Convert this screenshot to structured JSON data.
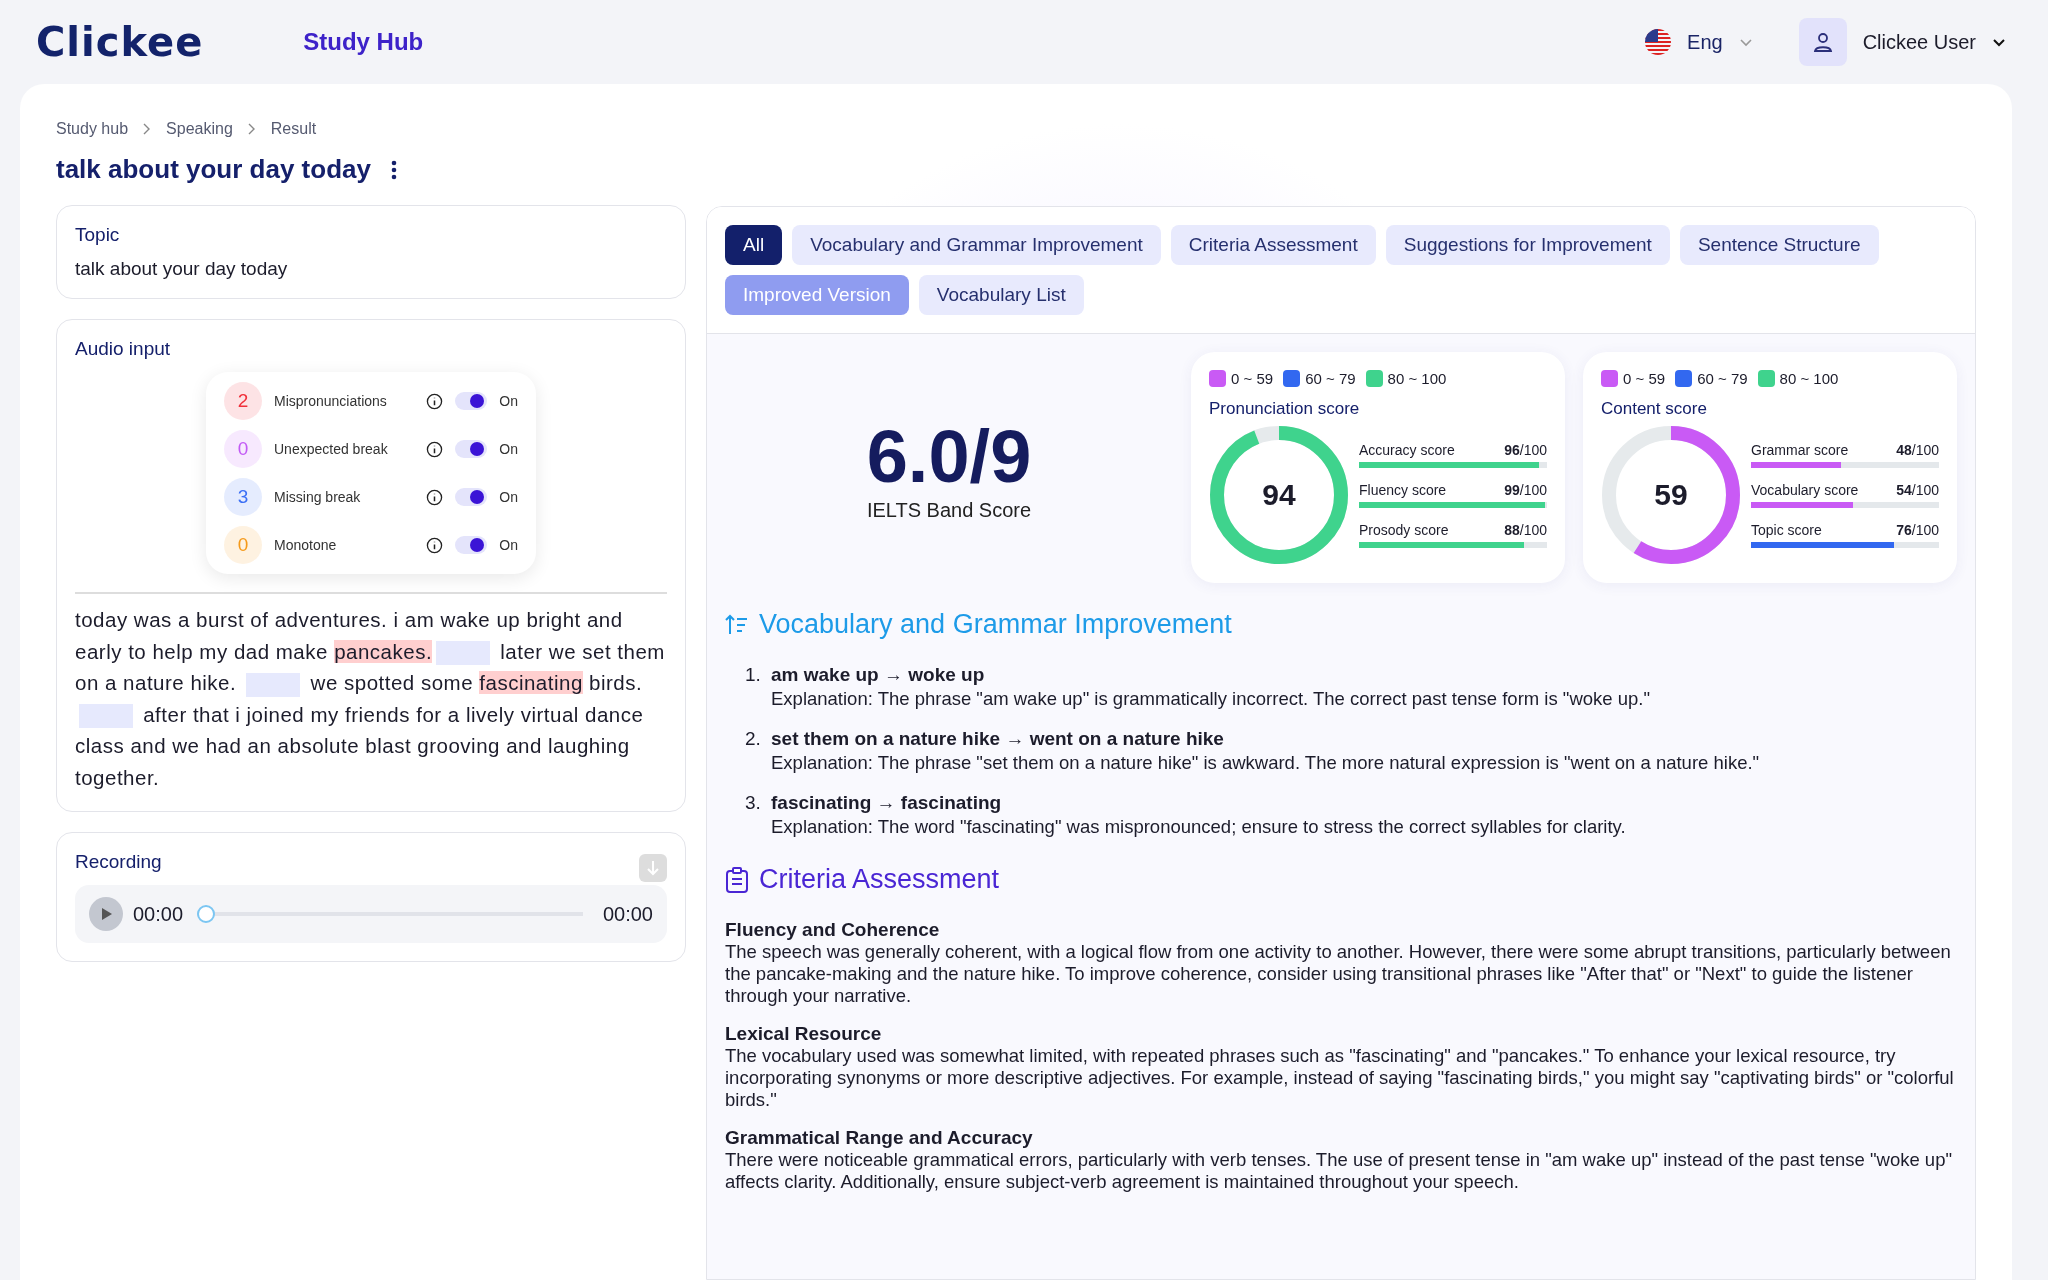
{
  "header": {
    "logo": "Clickee",
    "nav": "Study Hub",
    "language": "Eng",
    "user": "Clickee User"
  },
  "breadcrumb": [
    "Study hub",
    "Speaking",
    "Result"
  ],
  "title": "talk about your day today",
  "topic": {
    "heading": "Topic",
    "text": "talk about your day today"
  },
  "audio_input": {
    "heading": "Audio input",
    "flags": [
      {
        "count": "2",
        "label": "Mispronunciations",
        "on": true,
        "state": "On",
        "color": "#f0303a"
      },
      {
        "count": "0",
        "label": "Unexpected break",
        "on": true,
        "state": "On",
        "color": "#c25af5"
      },
      {
        "count": "3",
        "label": "Missing break",
        "on": true,
        "state": "On",
        "color": "#3b6ff5"
      },
      {
        "count": "0",
        "label": "Monotone",
        "on": true,
        "state": "On",
        "color": "#f59a1b"
      }
    ],
    "transcript": [
      {
        "kind": "text",
        "text": "today was a burst of adventures. i am wake up bright and early to help my dad make "
      },
      {
        "kind": "error",
        "text": "pancakes."
      },
      {
        "kind": "gap"
      },
      {
        "kind": "text",
        "text": " later we set them on a nature hike. "
      },
      {
        "kind": "gap"
      },
      {
        "kind": "text",
        "text": " we spotted some "
      },
      {
        "kind": "error",
        "text": "fascinating"
      },
      {
        "kind": "text",
        "text": " birds. "
      },
      {
        "kind": "gap"
      },
      {
        "kind": "text",
        "text": " after that i joined my friends for a lively virtual dance class and we had an absolute blast grooving and laughing together."
      }
    ]
  },
  "recording": {
    "heading": "Recording",
    "current": "00:00",
    "total": "00:00",
    "level": 0
  },
  "tabs": [
    {
      "label": "All",
      "selected": true,
      "disabled": false
    },
    {
      "label": "Vocabulary and Grammar Improvement",
      "selected": false,
      "disabled": false
    },
    {
      "label": "Criteria Assessment",
      "selected": false,
      "disabled": false
    },
    {
      "label": "Suggestions for Improvement",
      "selected": false,
      "disabled": false
    },
    {
      "label": "Sentence Structure",
      "selected": false,
      "disabled": false
    },
    {
      "label": "Improved Version",
      "selected": false,
      "disabled": true
    },
    {
      "label": "Vocabulary List",
      "selected": false,
      "disabled": false
    }
  ],
  "band": {
    "score": "6.0/9",
    "label": "IELTS Band Score"
  },
  "score_cards": [
    {
      "legend": [
        {
          "label": "0 ~ 59",
          "color": "#c95af5"
        },
        {
          "label": "60 ~ 79",
          "color": "#3268f0"
        },
        {
          "label": "80 ~ 100",
          "color": "#3fd38d"
        }
      ],
      "title": "Pronunciation score",
      "total": "94",
      "level": 0.94,
      "color": "#3fd38d",
      "bars": [
        {
          "label": "Accuracy score",
          "value": "96",
          "max": "/100",
          "level": 0.96,
          "color": "#3fd38d"
        },
        {
          "label": "Fluency score",
          "value": "99",
          "max": "/100",
          "level": 0.99,
          "color": "#3fd38d"
        },
        {
          "label": "Prosody score",
          "value": "88",
          "max": "/100",
          "level": 0.88,
          "color": "#3fd38d"
        }
      ]
    },
    {
      "legend": [
        {
          "label": "0 ~ 59",
          "color": "#c95af5"
        },
        {
          "label": "60 ~ 79",
          "color": "#3268f0"
        },
        {
          "label": "80 ~ 100",
          "color": "#3fd38d"
        }
      ],
      "title": "Content score",
      "total": "59",
      "level": 0.59,
      "color": "#c95af5",
      "bars": [
        {
          "label": "Grammar score",
          "value": "48",
          "max": "/100",
          "level": 0.48,
          "color": "#c95af5"
        },
        {
          "label": "Vocabulary score",
          "value": "54",
          "max": "/100",
          "level": 0.54,
          "color": "#c95af5"
        },
        {
          "label": "Topic score",
          "value": "76",
          "max": "/100",
          "level": 0.76,
          "color": "#3268f0"
        }
      ]
    }
  ],
  "sections": [
    {
      "kind": "list",
      "heading": "Vocabulary and Grammar Improvement",
      "items": [
        {
          "number": "1.",
          "title": "am wake up → woke up",
          "text": "Explanation: The phrase \"am wake up\" is grammatically incorrect. The correct past tense form is \"woke up.\""
        },
        {
          "number": "2.",
          "title": "set them on a nature hike → went on a nature hike",
          "text": "Explanation: The phrase \"set them on a nature hike\" is awkward. The more natural expression is \"went on a nature hike.\""
        },
        {
          "number": "3.",
          "title": "fascinating → fascinating",
          "text": "Explanation: The word \"fascinating\" was mispronounced; ensure to stress the correct syllables for clarity."
        }
      ]
    },
    {
      "kind": "criteria",
      "heading": "Criteria Assessment",
      "items": [
        {
          "title": "Fluency and Coherence",
          "text": "The speech was generally coherent, with a logical flow from one activity to another. However, there were some abrupt transitions, particularly between the pancake-making and the nature hike. To improve coherence, consider using transitional phrases like \"After that\" or \"Next\" to guide the listener through your narrative."
        },
        {
          "title": "Lexical Resource",
          "text": "The vocabulary used was somewhat limited, with repeated phrases such as \"fascinating\" and \"pancakes.\" To enhance your lexical resource, try incorporating synonyms or more descriptive adjectives. For example, instead of saying \"fascinating birds,\" you might say \"captivating birds\" or \"colorful birds.\""
        },
        {
          "title": "Grammatical Range and Accuracy",
          "text": "There were noticeable grammatical errors, particularly with verb tenses. The use of present tense in \"am wake up\" instead of the past tense \"woke up\" affects clarity. Additionally, ensure subject-verb agreement is maintained throughout your speech."
        }
      ]
    }
  ]
}
